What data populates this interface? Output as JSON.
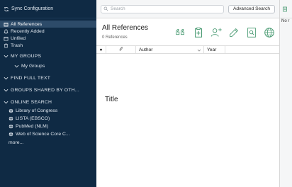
{
  "sidebar": {
    "sync_label": "Sync Configuration",
    "library_items": [
      {
        "label": "All References",
        "icon": "library-icon",
        "selected": true
      },
      {
        "label": "Recently Added",
        "icon": "recently-added-icon"
      },
      {
        "label": "Unfiled",
        "icon": "unfiled-icon"
      },
      {
        "label": "Trash",
        "icon": "trash-icon"
      }
    ],
    "sections": {
      "my_groups": "MY GROUPS",
      "my_groups_sub": "My Groups",
      "find_full_text": "FIND FULL TEXT",
      "groups_shared": "GROUPS SHARED BY OTH...",
      "online_search": "ONLINE SEARCH"
    },
    "online_search_items": [
      {
        "label": "Library of Congress",
        "icon": "globe-icon"
      },
      {
        "label": "LISTA (EBSCO)",
        "icon": "globe-icon"
      },
      {
        "label": "PubMed (NLM)",
        "icon": "globe-icon"
      },
      {
        "label": "Web of Science Core C...",
        "icon": "globe-icon"
      }
    ],
    "more_label": "more..."
  },
  "search": {
    "placeholder": "Search",
    "advanced_label": "Advanced Search"
  },
  "main": {
    "title": "All References",
    "count": "0 References",
    "actions": [
      "quote-icon",
      "insert-citation-icon",
      "add-user-icon",
      "edit-icon",
      "export-icon",
      "online-search-icon"
    ]
  },
  "table": {
    "columns": {
      "read": "●",
      "attachment": "📎",
      "author": "Author",
      "year": "Year",
      "title": "Title"
    },
    "sort_column": "Author",
    "sort_direction": "descending",
    "rows": []
  },
  "right_pane": {
    "text": "No r"
  },
  "colors": {
    "sidebar_bg": "#0f2a44",
    "sidebar_selected": "#2d4b69",
    "icon_green": "#4a9b73"
  }
}
